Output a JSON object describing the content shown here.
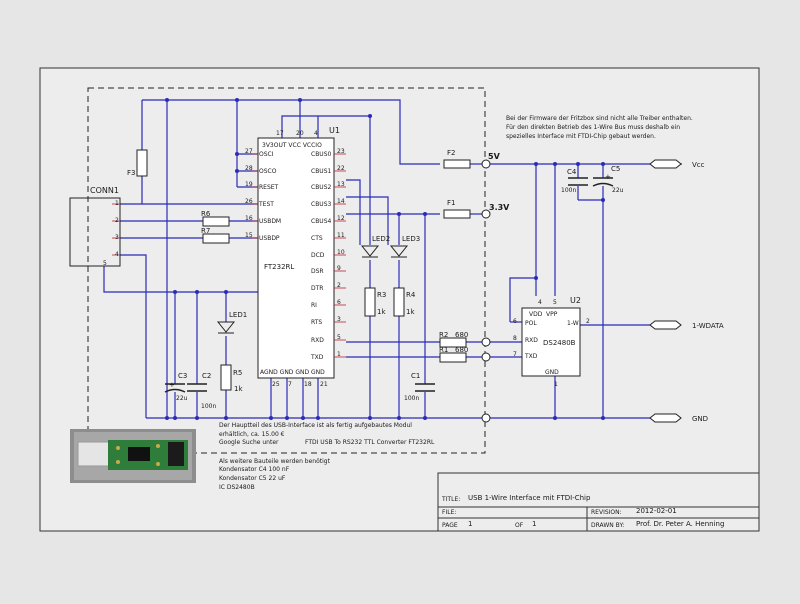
{
  "notes": {
    "firmware": [
      "Bei der Firmware der Fritzbox sind nicht alle Treiber enthalten.",
      "Für den direkten Betrieb des 1-Wire Bus muss deshalb ein",
      "spezielles Interface mit FTDI-Chip gebaut werden."
    ],
    "module": [
      "Der Hauptteil des USB-Interface ist als fertig aufgebautes Modul",
      "erhältlich, ca. 15.00 €",
      "Google Suche unter"
    ],
    "search_term": "FTDI USB To RS232 TTL Converter FT232RL",
    "parts": [
      "Als weitere Bauteile werden benötigt",
      "Kondensator C4 100 nF",
      "Kondensator C5 22 uF",
      "IC DS2480B"
    ]
  },
  "net_labels": {
    "vcc": "Vcc",
    "onewire": "1-WDATA",
    "gnd": "GND",
    "v5": "5V",
    "v33": "3.3V"
  },
  "components": {
    "conn1": "CONN1",
    "conn_pins": [
      "1",
      "2",
      "3",
      "4",
      "5"
    ],
    "u1": "U1",
    "u1_part": "FT232RL",
    "u1_top_pins": "3V3OUT VCC VCCIO",
    "u1_top_nums": [
      "17",
      "20",
      "4"
    ],
    "u1_left_pins": [
      [
        "27",
        "OSCI"
      ],
      [
        "28",
        "OSCO"
      ],
      [
        "19",
        "RESET"
      ],
      [
        "26",
        "TEST"
      ],
      [
        "16",
        "USBDM"
      ],
      [
        "15",
        "USBDP"
      ]
    ],
    "u1_right_pins": [
      [
        "23",
        "CBUS0"
      ],
      [
        "22",
        "CBUS1"
      ],
      [
        "13",
        "CBUS2"
      ],
      [
        "14",
        "CBUS3"
      ],
      [
        "12",
        "CBUS4"
      ],
      [
        "11",
        "CTS"
      ],
      [
        "10",
        "DCD"
      ],
      [
        "9",
        "DSR"
      ],
      [
        "2",
        "DTR"
      ],
      [
        "6",
        "RI"
      ],
      [
        "3",
        "RTS"
      ],
      [
        "5",
        "RXD"
      ],
      [
        "1",
        "TXD"
      ]
    ],
    "u1_bottom_pins": "AGND GND GND GND",
    "u1_bottom_nums": [
      "25",
      "7",
      "18",
      "21"
    ],
    "u2": "U2",
    "u2_part": "DS2480B",
    "u2_pins": {
      "vdd": "VDD",
      "vpp": "VPP",
      "pol": "POL",
      "rxd": "RXD",
      "txd": "TXD",
      "onew": "1-W",
      "gnd": "GND"
    },
    "u2_nums": {
      "vdd": "4",
      "vpp": "5",
      "pol": "6",
      "rxd": "8",
      "txd": "7",
      "onew": "2",
      "gnd": "1"
    },
    "f1": "F1",
    "f2": "F2",
    "f3": "F3",
    "r1": "R1",
    "r1_val": "680",
    "r2": "R2",
    "r2_val": "680",
    "r3": "R3",
    "r3_val": "1k",
    "r4": "R4",
    "r4_val": "1k",
    "r5": "R5",
    "r5_val": "1k",
    "r6": "R6",
    "r7": "R7",
    "led1": "LED1",
    "led2": "LED2",
    "led3": "LED3",
    "c1": "C1",
    "c1_val": "100n",
    "c2": "C2",
    "c2_val": "100n",
    "c3": "C3",
    "c3_val": "22u",
    "c4": "C4",
    "c4_val": "100n",
    "c5": "C5",
    "c5_val": "22u",
    "plus": "+"
  },
  "title_block": {
    "title_label": "TITLE:",
    "title": "USB 1-Wire Interface mit FTDI-Chip",
    "file_label": "FILE:",
    "file": "",
    "revision_label": "REVISION:",
    "revision": "2012-02-01",
    "page_label": "PAGE",
    "page": "1",
    "of_label": "OF",
    "of": "1",
    "drawn_label": "DRAWN BY:",
    "drawn_by": "Prof. Dr. Peter A. Henning"
  },
  "colors": {
    "wire": "#2b2bb8",
    "line": "#222222",
    "paper": "#ededed",
    "pin": "#bb2233"
  }
}
